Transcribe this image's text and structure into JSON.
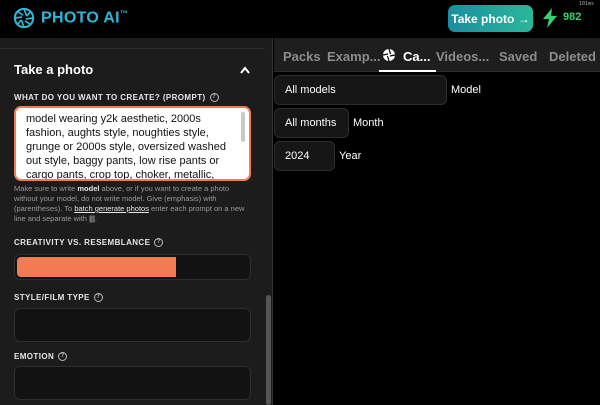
{
  "app": {
    "name": "PHOTO AI",
    "trademark": "™",
    "brand_color": "#2fb7d8"
  },
  "topbar": {
    "take_photo_label": "Take photo →",
    "credits": "982",
    "time_label": "101ms"
  },
  "left": {
    "section_title": "Take a photo",
    "prompt_label": "WHAT DO YOU WANT TO CREATE? (PROMPT)",
    "prompt_value": "model wearing y2k aesthetic, 2000s fashion, aughts style, noughties style, grunge or 2000s style, oversized washed out style, baggy pants, low rise pants or cargo pants, crop top, choker, metallic,",
    "hint_part1": "Make sure to write ",
    "hint_bold": "model",
    "hint_part2": " above, or if you want to create a photo without your model, do not write model. Give (emphasis) with (parentheses). To ",
    "hint_link": "batch generate photos",
    "hint_part3": " enter each prompt on a new line and separate with ",
    "hint_sep": "|||",
    "hint_end": ".",
    "creativity_label": "CREATIVITY VS. RESEMBLANCE",
    "creativity_value": 0.69,
    "style_label": "STYLE/FILM TYPE",
    "emotion_label": "EMOTION",
    "accent": "#f07c56"
  },
  "right": {
    "tabs": [
      {
        "label": "Packs"
      },
      {
        "label": "Examp..."
      },
      {
        "label": "Ca..."
      },
      {
        "label": "Videos..."
      },
      {
        "label": "Saved"
      },
      {
        "label": "Deleted"
      }
    ],
    "active_tab": "Ca...",
    "filters": [
      {
        "value": "All models",
        "label": "Model"
      },
      {
        "value": "All months",
        "label": "Month"
      },
      {
        "value": "2024",
        "label": "Year"
      }
    ]
  }
}
